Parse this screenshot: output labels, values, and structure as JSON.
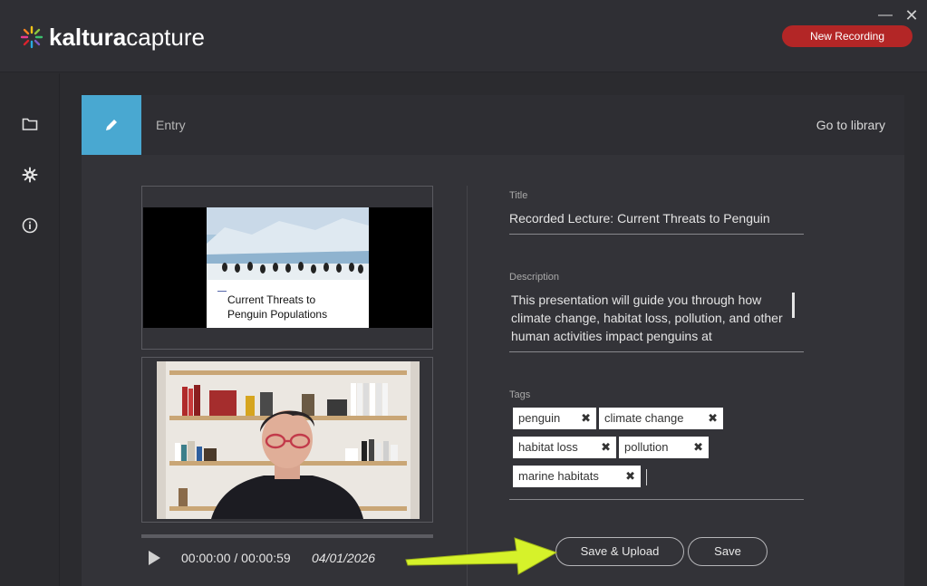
{
  "app": {
    "name_bold": "kaltura",
    "name_light": "capture",
    "new_recording": "New Recording",
    "minimize_glyph": "—",
    "close_glyph": "✕"
  },
  "sidebar": {
    "items": [
      {
        "icon": "folder-icon"
      },
      {
        "icon": "gear-icon"
      },
      {
        "icon": "info-icon"
      }
    ]
  },
  "header": {
    "entry_label": "Entry",
    "go_to_library": "Go to library"
  },
  "preview": {
    "slide_title_line1": "Current Threats to",
    "slide_title_line2": "Penguin Populations"
  },
  "player": {
    "time": "00:00:00 / 00:00:59",
    "date": "04/01/2026"
  },
  "form": {
    "title_label": "Title",
    "title_value": "Recorded Lecture: Current Threats to Penguin",
    "description_label": "Description",
    "description_value": "This presentation will guide you through how climate change, habitat loss, pollution, and other human activities impact penguins at",
    "tags_label": "Tags",
    "tags": [
      "penguin",
      "climate change",
      "habitat loss",
      "pollution",
      "marine habitats"
    ],
    "tag_remove_glyph": "✖"
  },
  "actions": {
    "save_upload": "Save & Upload",
    "save": "Save"
  },
  "colors": {
    "accent_blue": "#49a8d1",
    "record_red": "#b32626",
    "arrow_yellow": "#d6f22a"
  }
}
